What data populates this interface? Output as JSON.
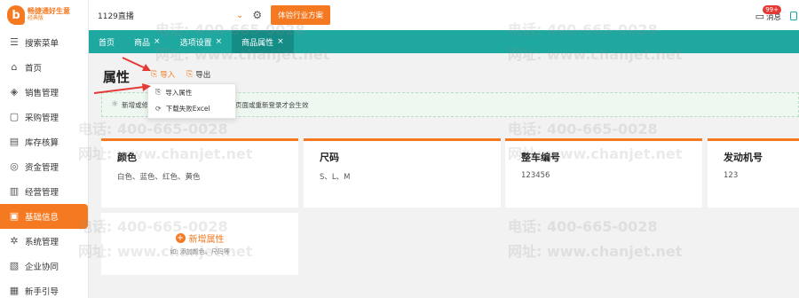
{
  "sidebar": {
    "logo": {
      "mark": "b",
      "name": "畅捷通好生意",
      "sub": "经典版"
    },
    "items": [
      {
        "label": "搜索菜单",
        "icon": "search-menu-icon",
        "glyph": "☰"
      },
      {
        "label": "首页",
        "icon": "home-icon",
        "glyph": "⌂"
      },
      {
        "label": "销售管理",
        "icon": "sales-icon",
        "glyph": "◈"
      },
      {
        "label": "采购管理",
        "icon": "purchase-icon",
        "glyph": "▢"
      },
      {
        "label": "库存核算",
        "icon": "inventory-icon",
        "glyph": "▤"
      },
      {
        "label": "资金管理",
        "icon": "funds-icon",
        "glyph": "◎"
      },
      {
        "label": "经营管理",
        "icon": "operation-icon",
        "glyph": "▥"
      },
      {
        "label": "基础信息",
        "icon": "basic-info-icon",
        "glyph": "▣"
      },
      {
        "label": "系统管理",
        "icon": "system-icon",
        "glyph": "✲"
      },
      {
        "label": "企业协同",
        "icon": "collab-icon",
        "glyph": "▧"
      },
      {
        "label": "新手引导",
        "icon": "guide-icon",
        "glyph": "▦"
      }
    ]
  },
  "topbar": {
    "org": "1129直播",
    "trial_button": "体验行业方案",
    "messages_label": "消息",
    "messages_badge": "99+"
  },
  "tabs": [
    {
      "label": "首页",
      "closable": false
    },
    {
      "label": "商品",
      "closable": true
    },
    {
      "label": "选项设置",
      "closable": true
    },
    {
      "label": "商品属性",
      "closable": true,
      "active": true
    }
  ],
  "main": {
    "title": "属性",
    "import_label": "导入",
    "export_label": "导出",
    "tip_start": "新增或修",
    "tip_end": "建\"刷新页面或重新登录才会生效",
    "dropdown": [
      "导入属性",
      "下载失败Excel"
    ],
    "cards": [
      {
        "name": "颜色",
        "value": "白色、蓝色、红色、黄色"
      },
      {
        "name": "尺码",
        "value": "S、L、M"
      },
      {
        "name": "整车编号",
        "value": "123456"
      },
      {
        "name": "发动机号",
        "value": "123"
      }
    ],
    "add_label": "新增属性",
    "add_hint": "如: 添加颜色、尺码等"
  },
  "watermark": {
    "phone": "电话: 400-665-0028",
    "site": "网址: www.chanjet.net"
  },
  "colors": {
    "accent": "#f47920",
    "teal": "#1fa8a0",
    "tab_active": "#168c86",
    "arrow": "#e53935"
  }
}
